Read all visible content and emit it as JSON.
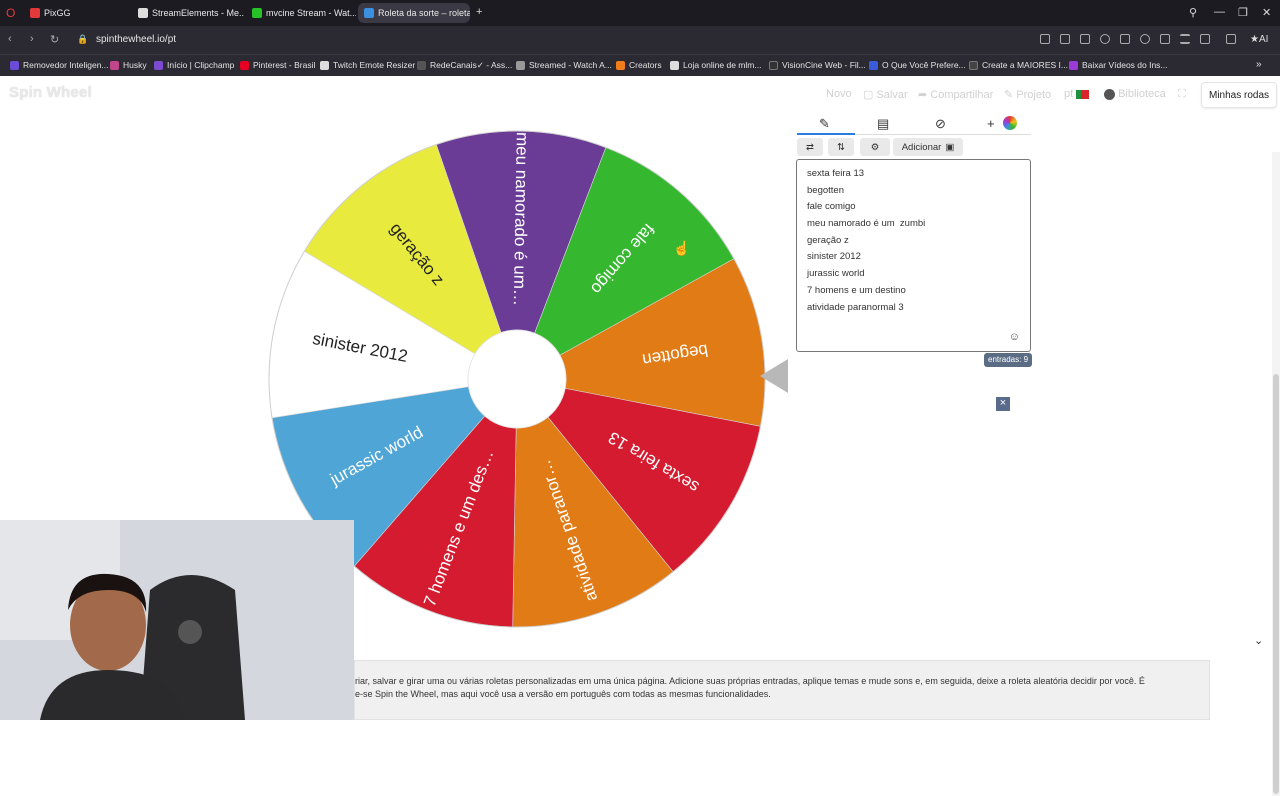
{
  "browser": {
    "tabs": [
      {
        "label": "PixGG",
        "color": "#e23a3a",
        "active": false
      },
      {
        "label": "StreamElements - Me...",
        "color": "#dddddd",
        "active": false
      },
      {
        "label": "mvcine Stream - Wat...",
        "color": "#25c228",
        "active": false
      },
      {
        "label": "Roleta da sorte – roleta c...",
        "color": "#3b8fe0",
        "active": true
      }
    ],
    "new_tab": "+",
    "url": "spinthewheel.io/pt",
    "bookmarks": [
      {
        "label": "Removedor Inteligen...",
        "color": "#6b4bd8"
      },
      {
        "label": "Husky",
        "color": "#c0458a"
      },
      {
        "label": "Início | Clipchamp",
        "color": "#7b4ad0"
      },
      {
        "label": "Pinterest - Brasil",
        "color": "#e60023"
      },
      {
        "label": "Twitch Emote Resizer",
        "color": "#dddddd"
      },
      {
        "label": "RedeCanais✓ - Ass...",
        "color": "#555555"
      },
      {
        "label": "Streamed - Watch A...",
        "color": "#999999"
      },
      {
        "label": "Creators",
        "color": "#f07c1a"
      },
      {
        "label": "Loja online de mlm...",
        "color": "#dddddd"
      },
      {
        "label": "VisionCine Web - Fil...",
        "color": "#333333"
      },
      {
        "label": "O Que Você Prefere...",
        "color": "#3b5bd8"
      },
      {
        "label": "Create a MAIORES I...",
        "color": "#444444"
      },
      {
        "label": "Baixar Vídeos do Ins...",
        "color": "#9b3bd8"
      }
    ]
  },
  "site": {
    "logo": "Spin Wheel",
    "nav": {
      "novo": "Novo",
      "salvar": "Salvar",
      "compartilhar": "Compartilhar",
      "projeto": "Projeto",
      "lang": "pt",
      "biblioteca": "Biblioteca",
      "minhas_rodas": "Minhas rodas"
    },
    "toolbar": {
      "adicionar": "Adicionar"
    },
    "entries": [
      "sexta feira 13",
      "begotten",
      "fale comigo",
      "meu namorado é um  zumbi",
      "geração z",
      "sinister 2012",
      "jurassic world",
      "7 homens e um destino",
      "atividade paranormal 3"
    ],
    "entry_count": "entradas: 9",
    "description_line1": "riar, salvar e girar uma ou várias roletas personalizadas em uma única página. Adicione suas próprias entradas, aplique temas e mude sons e, em seguida, deixe a roleta aleatória decidir por você. É",
    "description_line2": "e-se Spin the Wheel, mas aqui você usa a versão em português com todas as mesmas funcionalidades."
  },
  "wheel": {
    "slices": [
      {
        "label": "meu namorado é um…",
        "color": "#6a3c96"
      },
      {
        "label": "fale comigo",
        "color": "#35b82f"
      },
      {
        "label": "begotten",
        "color": "#e07b16"
      },
      {
        "label": "sexta feira 13",
        "color": "#d41b30"
      },
      {
        "label": "atividade paranor…",
        "color": "#e07b16"
      },
      {
        "label": "7 homens e um des…",
        "color": "#d41b30"
      },
      {
        "label": "jurassic world",
        "color": "#4ea5d6"
      },
      {
        "label": "sinister 2012",
        "color": "#ffffff"
      },
      {
        "label": "geração z",
        "color": "#e8ea3e"
      }
    ]
  }
}
